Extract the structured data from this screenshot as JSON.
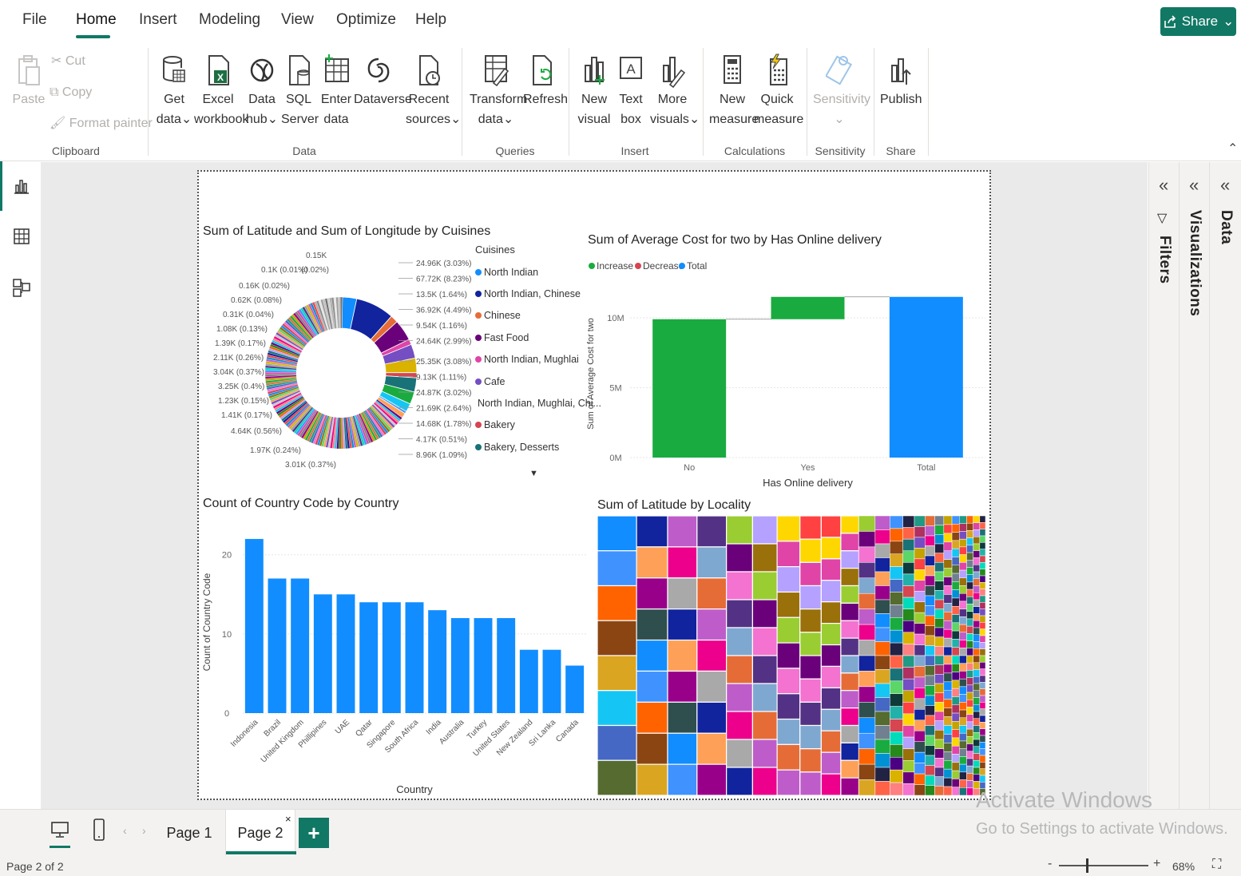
{
  "menu": {
    "items": [
      "File",
      "Home",
      "Insert",
      "Modeling",
      "View",
      "Optimize",
      "Help"
    ],
    "active": "Home",
    "share_label": "Share"
  },
  "ribbon": {
    "clipboard": {
      "paste": "Paste",
      "cut": "Cut",
      "copy": "Copy",
      "format_painter": "Format painter",
      "group": "Clipboard"
    },
    "data": {
      "get_data": [
        "Get",
        "data"
      ],
      "excel": [
        "Excel",
        "workbook"
      ],
      "data_hub": [
        "Data",
        "hub"
      ],
      "sql": [
        "SQL",
        "Server"
      ],
      "enter_data": [
        "Enter",
        "data"
      ],
      "dataverse": [
        "Dataverse"
      ],
      "recent": [
        "Recent",
        "sources"
      ],
      "group": "Data"
    },
    "queries": {
      "transform": [
        "Transform",
        "data"
      ],
      "refresh": [
        "Refresh"
      ],
      "group": "Queries"
    },
    "insert": {
      "new_visual": [
        "New",
        "visual"
      ],
      "text_box": [
        "Text",
        "box"
      ],
      "more_visuals": [
        "More",
        "visuals"
      ],
      "group": "Insert"
    },
    "calculations": {
      "new_measure": [
        "New",
        "measure"
      ],
      "quick_measure": [
        "Quick",
        "measure"
      ],
      "group": "Calculations"
    },
    "sensitivity": {
      "label": "Sensitivity",
      "group": "Sensitivity"
    },
    "share": {
      "publish": "Publish",
      "group": "Share"
    }
  },
  "panes": {
    "filters": "Filters",
    "visualizations": "Visualizations",
    "data": "Data"
  },
  "tabs": {
    "page1": "Page 1",
    "page2": "Page 2",
    "add": "+"
  },
  "status": {
    "page_info": "Page 2 of 2",
    "zoom": "68%"
  },
  "watermark": {
    "line1": "Activate Windows",
    "line2": "Go to Settings to activate Windows."
  },
  "colors": {
    "accent": "#117865",
    "increase": "#1aab40",
    "decrease": "#d64550",
    "total": "#118dff"
  },
  "chart_data": [
    {
      "type": "pie",
      "title": "Sum of Latitude and Sum of Longitude by Cuisines",
      "legend_title": "Cuisines",
      "legend": [
        {
          "name": "North Indian",
          "color": "#118dff"
        },
        {
          "name": "North Indian, Chinese",
          "color": "#12239e"
        },
        {
          "name": "Chinese",
          "color": "#e66c37"
        },
        {
          "name": "Fast Food",
          "color": "#6b007b"
        },
        {
          "name": "North Indian, Mughlai",
          "color": "#e044a7"
        },
        {
          "name": "Cafe",
          "color": "#744ec2"
        },
        {
          "name": "North Indian, Mughlai, Chi...",
          "color": "#d9b300"
        },
        {
          "name": "Bakery",
          "color": "#d64550"
        },
        {
          "name": "Bakery, Desserts",
          "color": "#197278"
        }
      ],
      "labels_right": [
        "24.96K (3.03%)",
        "67.72K (8.23%)",
        "13.5K (1.64%)",
        "36.92K (4.49%)",
        "9.54K (1.16%)",
        "24.64K (2.99%)",
        "25.35K (3.08%)",
        "9.13K (1.11%)",
        "24.87K (3.02%)",
        "21.69K (2.64%)",
        "14.68K (1.78%)",
        "4.17K (0.51%)",
        "8.96K (1.09%)"
      ],
      "labels_left": [
        "0.15K",
        "0.1K (0.01%)",
        "(0.02%)",
        "0.16K (0.02%)",
        "0.62K (0.08%)",
        "0.31K (0.04%)",
        "1.08K (0.13%)",
        "1.39K (0.17%)",
        "2.11K (0.26%)",
        "3.04K (0.37%)",
        "3.25K (0.4%)",
        "1.23K (0.15%)",
        "1.41K (0.17%)",
        "4.64K (0.56%)",
        "1.97K (0.24%)",
        "3.01K (0.37%)"
      ]
    },
    {
      "type": "bar",
      "title": "Sum of Average Cost for two by Has Online delivery",
      "subtype": "waterfall",
      "legend": [
        "Increase",
        "Decrease",
        "Total"
      ],
      "xlabel": "Has Online delivery",
      "ylabel": "Sum of Average Cost for two",
      "categories": [
        "No",
        "Yes",
        "Total"
      ],
      "values": [
        9.9,
        1.6,
        11.5
      ],
      "yticks": [
        "0M",
        "5M",
        "10M"
      ],
      "ylim": [
        0,
        12
      ]
    },
    {
      "type": "bar",
      "title": "Count of Country Code by Country",
      "xlabel": "Country",
      "ylabel": "Count of Country Code",
      "categories": [
        "Indonesia",
        "Brazil",
        "United Kingdom",
        "Phillipines",
        "UAE",
        "Qatar",
        "Singapore",
        "South Africa",
        "India",
        "Australia",
        "Turkey",
        "United States",
        "New Zealand",
        "Sri Lanka",
        "Canada"
      ],
      "values": [
        22,
        17,
        17,
        15,
        15,
        14,
        14,
        14,
        13,
        12,
        12,
        12,
        8,
        8,
        6
      ],
      "yticks": [
        0,
        10,
        20
      ],
      "ylim": [
        0,
        23
      ]
    },
    {
      "type": "heatmap",
      "subtype": "treemap",
      "title": "Sum of Latitude by Locality"
    }
  ]
}
